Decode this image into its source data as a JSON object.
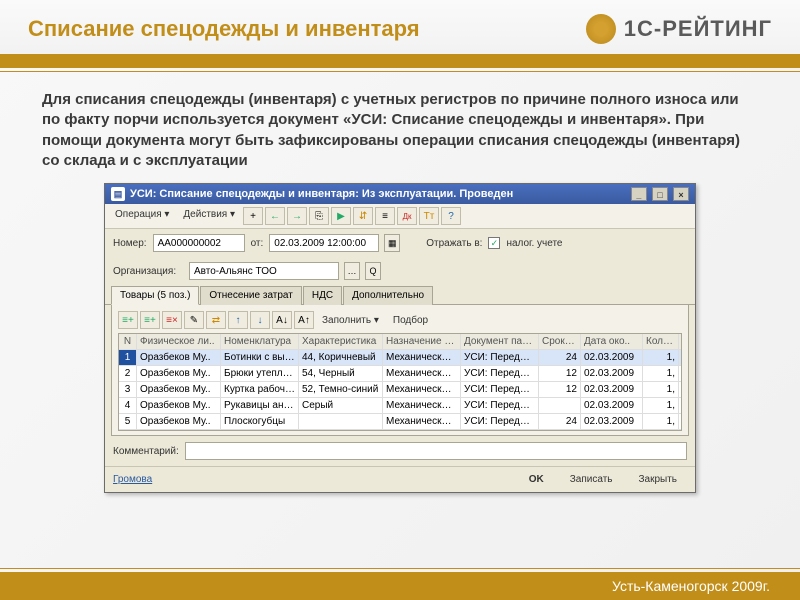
{
  "header": {
    "title": "Списание спецодежды и инвентаря",
    "logo": "1С-РЕЙТИНГ"
  },
  "description": "Для списания спецодежды (инвентаря) с учетных регистров по причине полного износа или по факту порчи используется документ «УСИ: Списание спецодежды и инвентаря». При помощи документа могут быть зафиксированы операции списания спецодежды (инвентаря) со склада и с эксплуатации",
  "win": {
    "title": "УСИ: Списание спецодежды и инвентаря: Из эксплуатации. Проведен",
    "menu": {
      "operation": "Операция ▾",
      "actions": "Действия ▾"
    },
    "form": {
      "number_label": "Номер:",
      "number": "АА000000002",
      "from_label": "от:",
      "date": "02.03.2009 12:00:00",
      "reflect_label": "Отражать в:",
      "reflect_value": "налог. учете",
      "org_label": "Организация:",
      "org": "Авто-Альянс ТОО"
    },
    "tabs": {
      "goods": "Товары (5 поз.)",
      "cost": "Отнесение затрат",
      "nds": "НДС",
      "extra": "Дополнительно"
    },
    "sub": {
      "fill": "Заполнить ▾",
      "select": "Подбор"
    },
    "columns": [
      "N",
      "Физическое ли..",
      "Номенклатура",
      "Характеристика",
      "Назначение ис..",
      "Документ парт..",
      "Срок с..",
      "Дата око..",
      "Колич.."
    ],
    "rows": [
      {
        "n": "1",
        "p": "Оразбеков Му..",
        "nom": "Ботинки с выс..",
        "ch": "44, Коричневый",
        "naz": "Механический..",
        "doc": "УСИ: Передач..",
        "sr": "24",
        "dt": "02.03.2009",
        "k": "1,"
      },
      {
        "n": "2",
        "p": "Оразбеков Му..",
        "nom": "Брюки утеплен..",
        "ch": "54, Черный",
        "naz": "Механический..",
        "doc": "УСИ: Передач..",
        "sr": "12",
        "dt": "02.03.2009",
        "k": "1,"
      },
      {
        "n": "3",
        "p": "Оразбеков Му..",
        "nom": "Куртка рабочая",
        "ch": "52, Темно-синий",
        "naz": "Механический..",
        "doc": "УСИ: Передач..",
        "sr": "12",
        "dt": "02.03.2009",
        "k": "1,"
      },
      {
        "n": "4",
        "p": "Оразбеков Му..",
        "nom": "Рукавицы анти..",
        "ch": "Серый",
        "naz": "Механический..",
        "doc": "УСИ: Передач..",
        "sr": "",
        "dt": "02.03.2009",
        "k": "1,"
      },
      {
        "n": "5",
        "p": "Оразбеков Му..",
        "nom": "Плоскогубцы",
        "ch": "",
        "naz": "Механический..",
        "doc": "УСИ: Передач..",
        "sr": "24",
        "dt": "02.03.2009",
        "k": "1,"
      }
    ],
    "comment_label": "Комментарий:",
    "user": "Громова",
    "buttons": {
      "ok": "OK",
      "save": "Записать",
      "close": "Закрыть"
    }
  },
  "footer": "Усть-Каменогорск 2009г."
}
